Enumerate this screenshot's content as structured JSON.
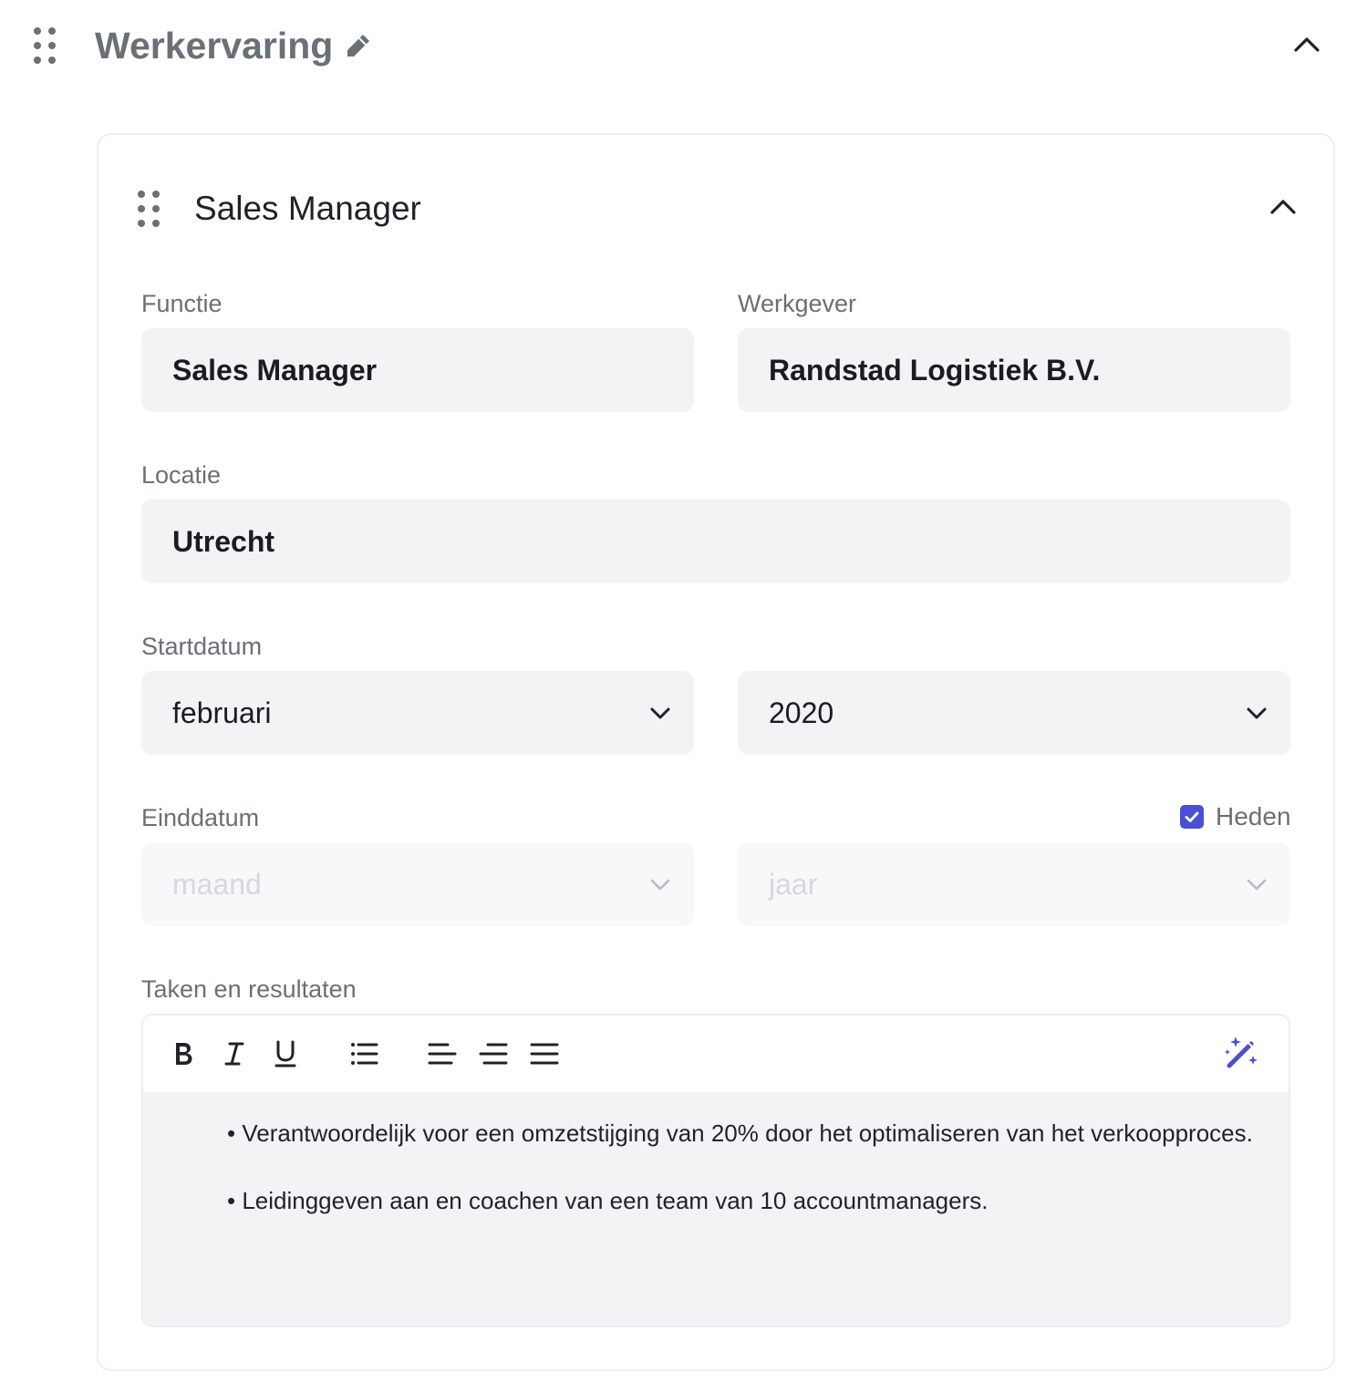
{
  "section": {
    "title": "Werkervaring",
    "icons": {
      "drag": "drag-handle-icon",
      "edit": "pencil-icon",
      "collapse": "chevron-up-icon"
    }
  },
  "entry": {
    "title": "Sales Manager",
    "functie": {
      "label": "Functie",
      "value": "Sales Manager"
    },
    "werkgever": {
      "label": "Werkgever",
      "value": "Randstad Logistiek B.V."
    },
    "locatie": {
      "label": "Locatie",
      "value": "Utrecht"
    },
    "startdatum": {
      "label": "Startdatum",
      "month": "februari",
      "year": "2020"
    },
    "einddatum": {
      "label": "Einddatum",
      "month_placeholder": "maand",
      "year_placeholder": "jaar",
      "current_label": "Heden",
      "current_checked": true
    },
    "tasks": {
      "label": "Taken en resultaten",
      "toolbar": [
        "bold-icon",
        "italic-icon",
        "underline-icon",
        "bullet-list-icon",
        "align-left-icon",
        "align-right-icon",
        "align-justify-icon",
        "magic-wand-icon"
      ],
      "items": [
        "Verantwoordelijk voor een omzetstijging van 20% door het optimaliseren van het verkoopproces.",
        "Leidinggeven aan en coachen van een team van 10 accountmanagers."
      ]
    }
  },
  "colors": {
    "accent": "#4a4fd6",
    "field_bg": "#f2f3f5",
    "label": "#6b6f76"
  }
}
